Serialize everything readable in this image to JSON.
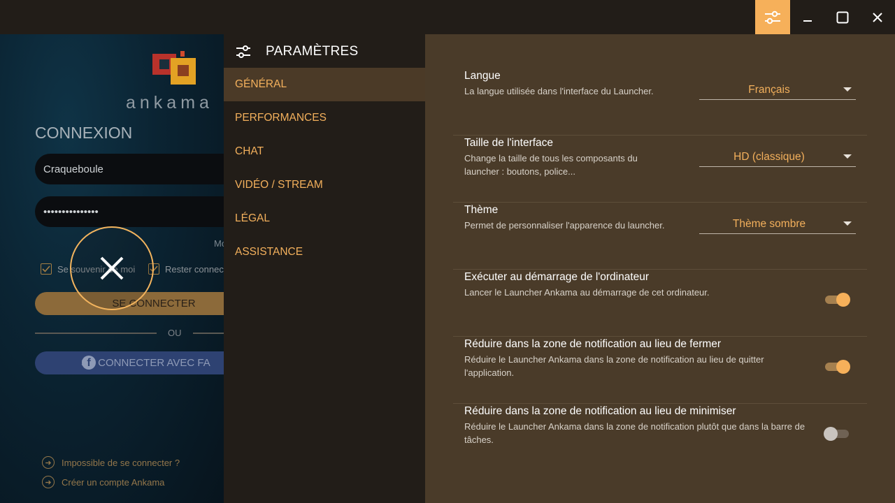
{
  "login": {
    "logo_text": "ankama",
    "title": "CONNEXION",
    "username_value": "Craqueboule",
    "password_value": "•••••••••••••••",
    "forgot_text": "Mo",
    "remember_label": "Se souvenir de moi",
    "stay_connected_label": "Rester connec",
    "connect_button": "SE CONNECTER",
    "or_text": "OU",
    "facebook_button": "SE CONNECTER AVEC FA",
    "link_cannot_connect": "Impossible de se connecter ?",
    "link_create_account": "Créer un compte Ankama"
  },
  "settings": {
    "title": "PARAMÈTRES",
    "nav": [
      {
        "label": "GÉNÉRAL",
        "active": true
      },
      {
        "label": "PERFORMANCES",
        "active": false
      },
      {
        "label": "CHAT",
        "active": false
      },
      {
        "label": "VIDÉO / STREAM",
        "active": false
      },
      {
        "label": "LÉGAL",
        "active": false
      },
      {
        "label": "ASSISTANCE",
        "active": false
      }
    ],
    "rows": [
      {
        "title": "Langue",
        "desc": "La langue utilisée dans l'interface du Launcher.",
        "select": "Français"
      },
      {
        "title": "Taille de l'interface",
        "desc": "Change la taille de tous les composants du launcher : boutons, police...",
        "select": "HD (classique)"
      },
      {
        "title": "Thème",
        "desc": "Permet de personnaliser l'apparence du launcher.",
        "select": "Thème sombre"
      },
      {
        "title": "Exécuter au démarrage de l'ordinateur",
        "desc": "Lancer le Launcher Ankama au démarrage de cet ordinateur.",
        "toggle": true
      },
      {
        "title": "Réduire dans la zone de notification au lieu de fermer",
        "desc": "Réduire le Launcher Ankama dans la zone de notification au lieu de quitter l'application.",
        "toggle": true
      },
      {
        "title": "Réduire dans la zone de notification au lieu de minimiser",
        "desc": "Réduire le Launcher Ankama dans la zone de notification plutôt que dans la barre de tâches.",
        "toggle": false
      }
    ]
  },
  "colors": {
    "accent": "#f6b05a",
    "panel": "#4a3b29",
    "nav_bg": "#221d18"
  }
}
